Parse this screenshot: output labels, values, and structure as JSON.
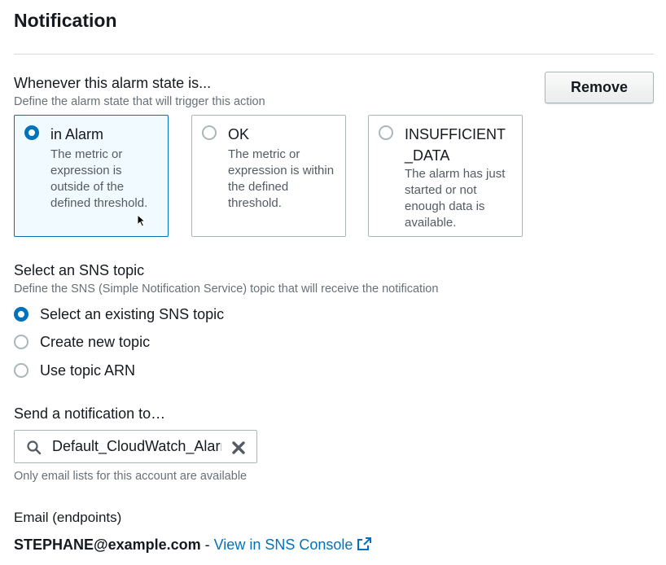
{
  "section": {
    "title": "Notification"
  },
  "remove_button": {
    "label": "Remove"
  },
  "alarm_state": {
    "label": "Whenever this alarm state is...",
    "description": "Define the alarm state that will trigger this action",
    "options": [
      {
        "title": "in Alarm",
        "description": "The metric or expression is outside of the defined threshold.",
        "selected": true
      },
      {
        "title": "OK",
        "description": "The metric or expression is within the defined threshold.",
        "selected": false
      },
      {
        "title": "INSUFFICIENT\n_DATA",
        "description": "The alarm has just started or not enough data is available.",
        "selected": false
      }
    ]
  },
  "sns_topic": {
    "label": "Select an SNS topic",
    "description": "Define the SNS (Simple Notification Service) topic that will receive the notification",
    "options": [
      {
        "label": "Select an existing SNS topic",
        "selected": true
      },
      {
        "label": "Create new topic",
        "selected": false
      },
      {
        "label": "Use topic ARN",
        "selected": false
      }
    ]
  },
  "send_to": {
    "label": "Send a notification to…",
    "search_value": "Default_CloudWatch_Alarms_Topic",
    "hint": "Only email lists for this account are available"
  },
  "endpoints": {
    "label": "Email (endpoints)",
    "email": "STEPHANE@example.com",
    "separator": " - ",
    "link_label": "View in SNS Console"
  },
  "colors": {
    "accent": "#0073bb",
    "selected_card_bg": "#f1faff",
    "muted_text": "#687078"
  },
  "icons": {
    "search": "search-icon",
    "clear": "clear-icon",
    "external_link": "external-link-icon"
  }
}
